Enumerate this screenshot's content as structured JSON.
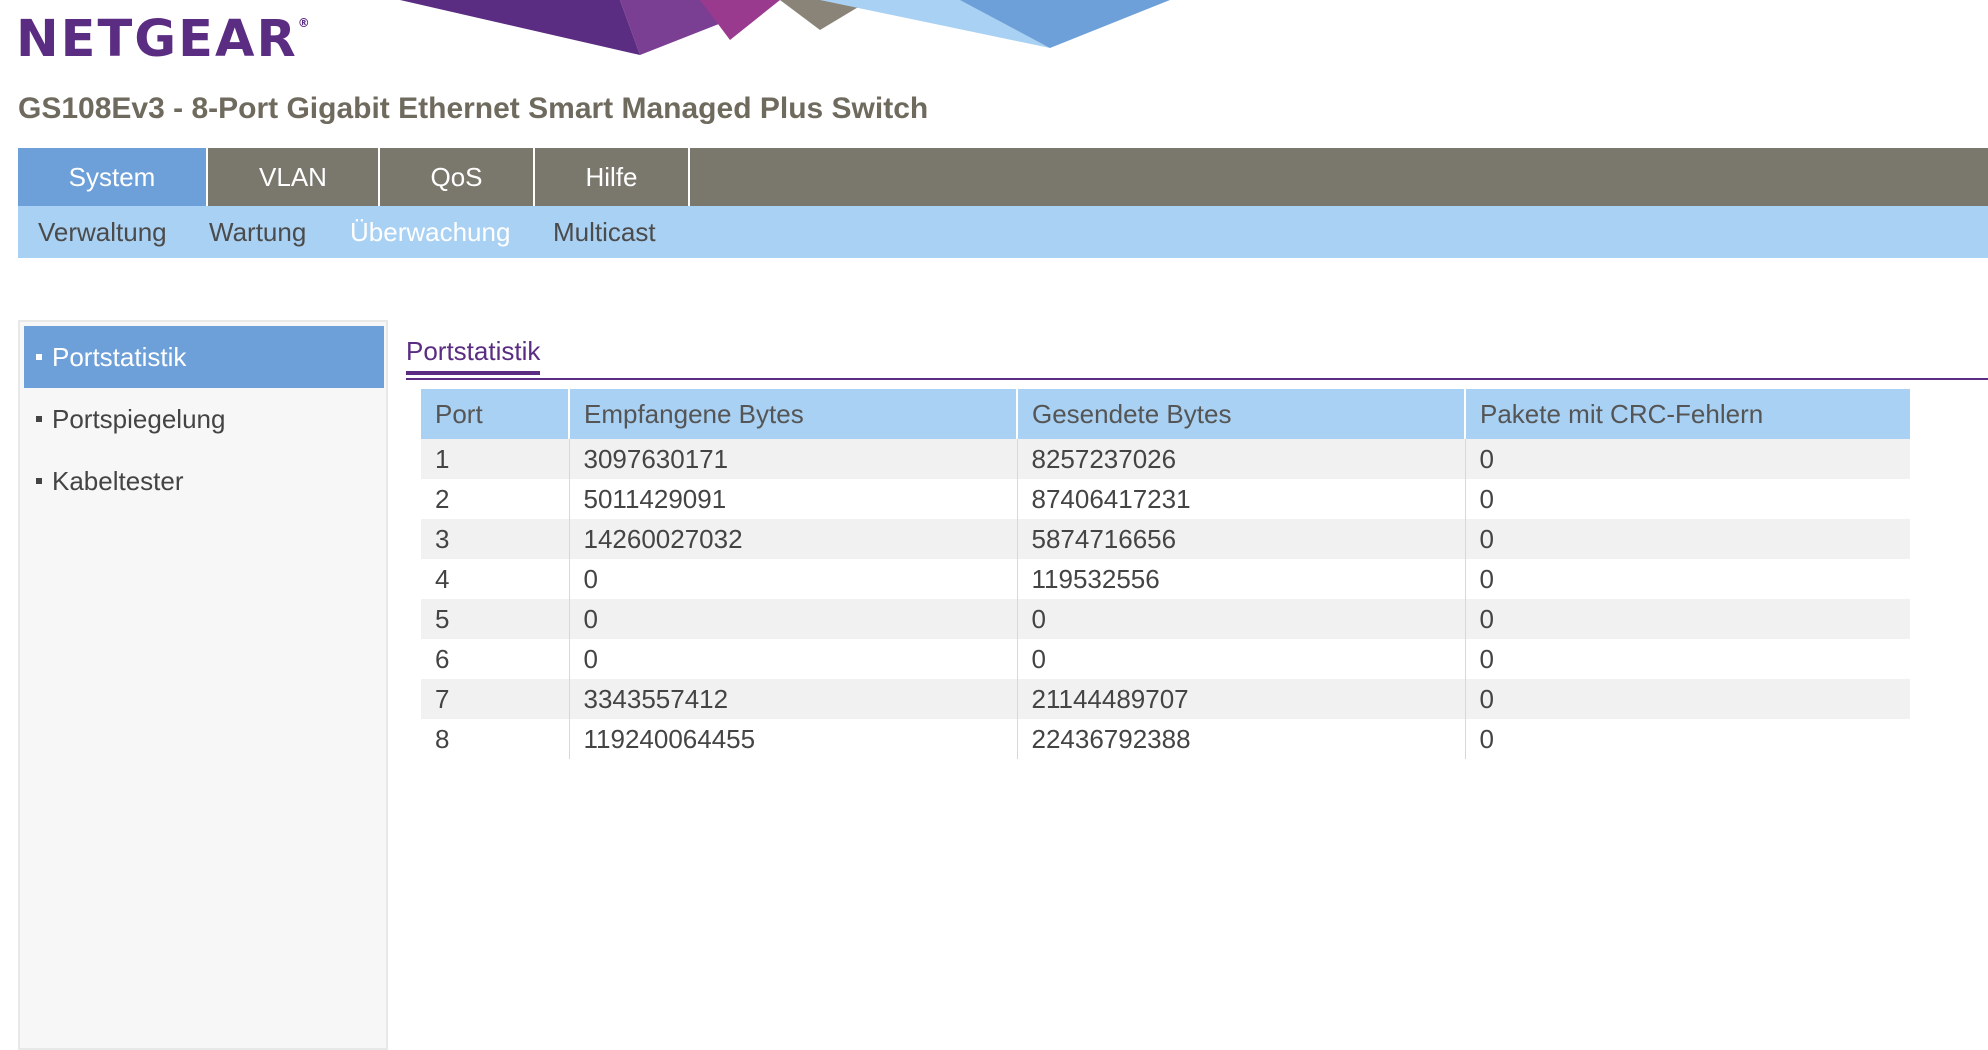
{
  "header": {
    "logo_text": "NETGEAR",
    "logo_mark": "®",
    "product_title": "GS108Ev3 - 8-Port Gigabit Ethernet Smart Managed Plus Switch",
    "banner_colors": [
      "#5b2d82",
      "#9a3a8f",
      "#8a8478",
      "#a9d1f3",
      "#6d9fd8"
    ]
  },
  "main_nav": {
    "tabs": [
      {
        "label": "System",
        "active": true
      },
      {
        "label": "VLAN",
        "active": false
      },
      {
        "label": "QoS",
        "active": false
      },
      {
        "label": "Hilfe",
        "active": false
      }
    ]
  },
  "sub_nav": {
    "items": [
      {
        "label": "Verwaltung",
        "active": false
      },
      {
        "label": "Wartung",
        "active": false
      },
      {
        "label": "Überwachung",
        "active": true
      },
      {
        "label": "Multicast",
        "active": false
      }
    ]
  },
  "sidebar": {
    "items": [
      {
        "label": "Portstatistik",
        "active": true
      },
      {
        "label": "Portspiegelung",
        "active": false
      },
      {
        "label": "Kabeltester",
        "active": false
      }
    ]
  },
  "content": {
    "tab_title": "Portstatistik",
    "table": {
      "columns": [
        "Port",
        "Empfangene Bytes",
        "Gesendete Bytes",
        "Pakete mit CRC-Fehlern"
      ],
      "rows": [
        [
          "1",
          "3097630171",
          "8257237026",
          "0"
        ],
        [
          "2",
          "5011429091",
          "87406417231",
          "0"
        ],
        [
          "3",
          "14260027032",
          "5874716656",
          "0"
        ],
        [
          "4",
          "0",
          "119532556",
          "0"
        ],
        [
          "5",
          "0",
          "0",
          "0"
        ],
        [
          "6",
          "0",
          "0",
          "0"
        ],
        [
          "7",
          "3343557412",
          "21144489707",
          "0"
        ],
        [
          "8",
          "119240064455",
          "22436792388",
          "0"
        ]
      ]
    }
  },
  "colors": {
    "brand_purple": "#5b2d82",
    "nav_gray": "#7a776c",
    "active_blue": "#6d9fd8",
    "light_blue": "#a9d1f3"
  }
}
